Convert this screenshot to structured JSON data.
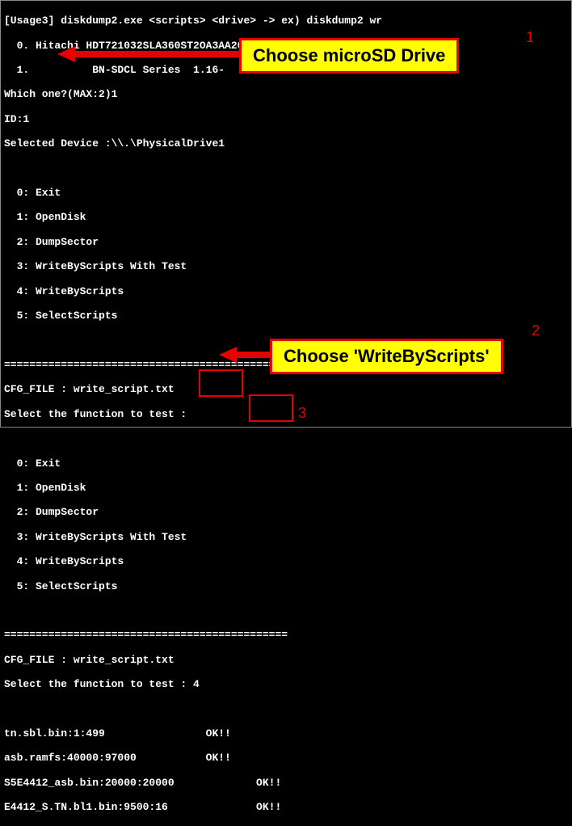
{
  "term": {
    "l1": "[Usage3] diskdump2.exe <scripts> <drive> -> ex) diskdump2 wr",
    "l2": "  0. Hitachi HDT721032SLA360ST2OA3AA202020202020545332463730",
    "l3": "  1.          BN-SDCL Series  1.16-",
    "l4": "Which one?(MAX:2)1",
    "l5": "ID:1",
    "l6": "Selected Device :\\\\.\\PhysicalDrive1",
    "l7": " ",
    "l8": "  0: Exit",
    "l9": "  1: OpenDisk",
    "l10": "  2: DumpSector",
    "l11": "  3: WriteByScripts With Test",
    "l12": "  4: WriteByScripts",
    "l13": "  5: SelectScripts",
    "l14": " ",
    "l15": "=============================================",
    "l16": "CFG_FILE : write_script.txt",
    "l17": "Select the function to test :",
    "l18": " ",
    "l19": "  0: Exit",
    "l20": "  1: OpenDisk",
    "l21": "  2: DumpSector",
    "l22": "  3: WriteByScripts With Test",
    "l23": "  4: WriteByScripts",
    "l24": "  5: SelectScripts",
    "l25": " ",
    "l26": "=============================================",
    "l27": "CFG_FILE : write_script.txt",
    "l28": "Select the function to test : 4",
    "l29": " ",
    "l30": "tn.sbl.bin:1:499                OK!!",
    "l31": "asb.ramfs:40000:97000           OK!!",
    "l32": "S5E4412_asb.bin:20000:20000             OK!!",
    "l33": "E4412_S.TN.bl1.bin:9500:16              OK!!"
  },
  "callouts": {
    "c1": "Choose microSD Drive",
    "c2": "Choose 'WriteByScripts'"
  },
  "labels": {
    "n1": "1",
    "n2": "2",
    "n3": "3"
  }
}
